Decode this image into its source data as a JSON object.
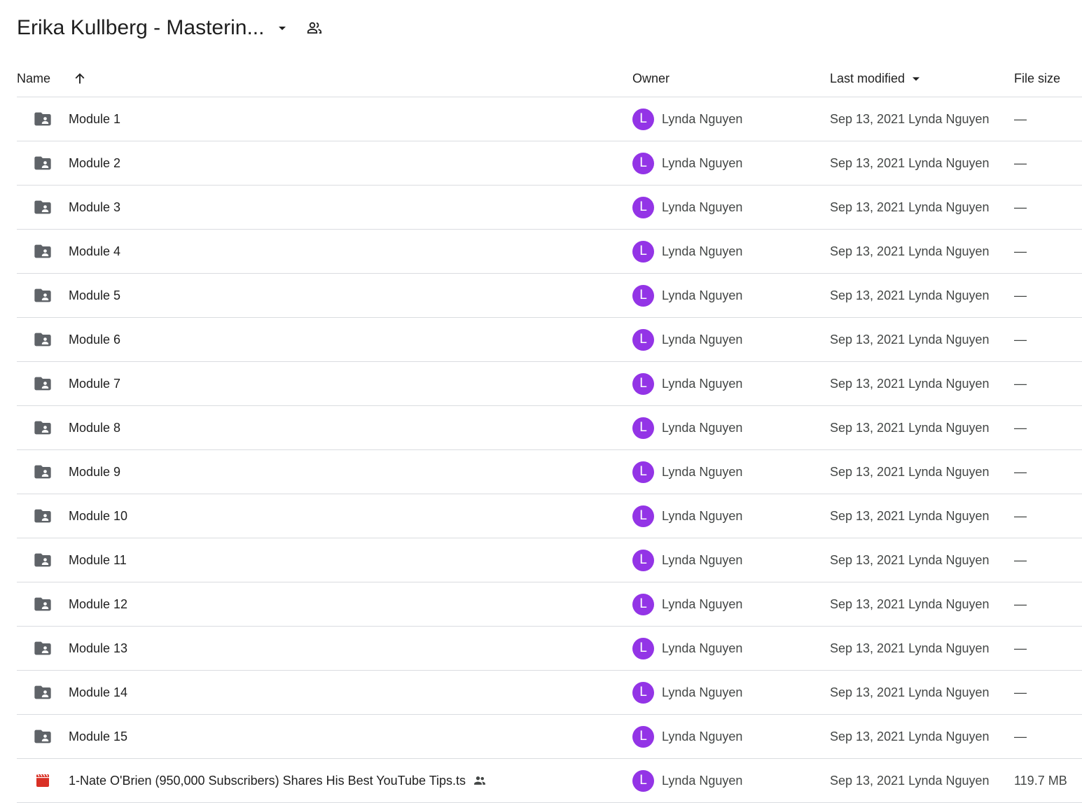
{
  "header": {
    "title": "Erika Kullberg - Masterin...",
    "caret_icon": "arrow-drop-down-icon",
    "shared_icon": "people-icon"
  },
  "columns": {
    "name": "Name",
    "sort_icon": "arrow-upward-icon",
    "owner": "Owner",
    "last_modified": "Last modified",
    "last_modified_icon": "arrow-drop-down-icon",
    "file_size": "File size"
  },
  "colors": {
    "avatar": "#9334e6",
    "folder_icon": "#5f6368",
    "video_icon": "#d93025",
    "divider": "#dadce0"
  },
  "rows": [
    {
      "type": "shared-folder",
      "name": "Module 1",
      "avatar": "L",
      "owner": "Lynda Nguyen",
      "modified": "Sep 13, 2021 Lynda Nguyen",
      "size": "—"
    },
    {
      "type": "shared-folder",
      "name": "Module 2",
      "avatar": "L",
      "owner": "Lynda Nguyen",
      "modified": "Sep 13, 2021 Lynda Nguyen",
      "size": "—"
    },
    {
      "type": "shared-folder",
      "name": "Module 3",
      "avatar": "L",
      "owner": "Lynda Nguyen",
      "modified": "Sep 13, 2021 Lynda Nguyen",
      "size": "—"
    },
    {
      "type": "shared-folder",
      "name": "Module 4",
      "avatar": "L",
      "owner": "Lynda Nguyen",
      "modified": "Sep 13, 2021 Lynda Nguyen",
      "size": "—"
    },
    {
      "type": "shared-folder",
      "name": "Module 5",
      "avatar": "L",
      "owner": "Lynda Nguyen",
      "modified": "Sep 13, 2021 Lynda Nguyen",
      "size": "—"
    },
    {
      "type": "shared-folder",
      "name": "Module 6",
      "avatar": "L",
      "owner": "Lynda Nguyen",
      "modified": "Sep 13, 2021 Lynda Nguyen",
      "size": "—"
    },
    {
      "type": "shared-folder",
      "name": "Module 7",
      "avatar": "L",
      "owner": "Lynda Nguyen",
      "modified": "Sep 13, 2021 Lynda Nguyen",
      "size": "—"
    },
    {
      "type": "shared-folder",
      "name": "Module 8",
      "avatar": "L",
      "owner": "Lynda Nguyen",
      "modified": "Sep 13, 2021 Lynda Nguyen",
      "size": "—"
    },
    {
      "type": "shared-folder",
      "name": "Module 9",
      "avatar": "L",
      "owner": "Lynda Nguyen",
      "modified": "Sep 13, 2021 Lynda Nguyen",
      "size": "—"
    },
    {
      "type": "shared-folder",
      "name": "Module 10",
      "avatar": "L",
      "owner": "Lynda Nguyen",
      "modified": "Sep 13, 2021 Lynda Nguyen",
      "size": "—"
    },
    {
      "type": "shared-folder",
      "name": "Module 11",
      "avatar": "L",
      "owner": "Lynda Nguyen",
      "modified": "Sep 13, 2021 Lynda Nguyen",
      "size": "—"
    },
    {
      "type": "shared-folder",
      "name": "Module 12",
      "avatar": "L",
      "owner": "Lynda Nguyen",
      "modified": "Sep 13, 2021 Lynda Nguyen",
      "size": "—"
    },
    {
      "type": "shared-folder",
      "name": "Module 13",
      "avatar": "L",
      "owner": "Lynda Nguyen",
      "modified": "Sep 13, 2021 Lynda Nguyen",
      "size": "—"
    },
    {
      "type": "shared-folder",
      "name": "Module 14",
      "avatar": "L",
      "owner": "Lynda Nguyen",
      "modified": "Sep 13, 2021 Lynda Nguyen",
      "size": "—"
    },
    {
      "type": "shared-folder",
      "name": "Module 15",
      "avatar": "L",
      "owner": "Lynda Nguyen",
      "modified": "Sep 13, 2021 Lynda Nguyen",
      "size": "—"
    },
    {
      "type": "video",
      "name": "1-Nate O'Brien (950,000 Subscribers) Shares His Best YouTube Tips.ts",
      "shared": true,
      "avatar": "L",
      "owner": "Lynda Nguyen",
      "modified": "Sep 13, 2021 Lynda Nguyen",
      "size": "119.7 MB"
    }
  ]
}
